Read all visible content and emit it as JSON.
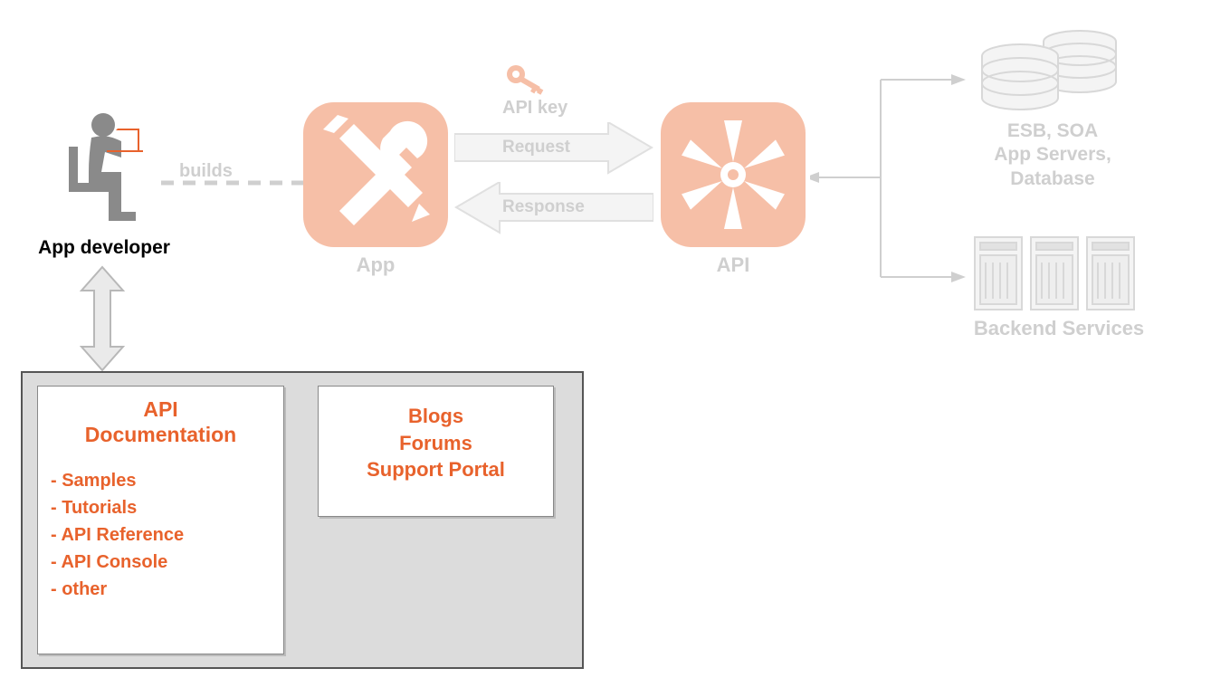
{
  "diagram": {
    "developer_label": "App developer",
    "builds_label": "builds",
    "app_label": "App",
    "api_key_label": "API key",
    "request_label": "Request",
    "response_label": "Response",
    "api_label": "API",
    "backend_top_line1": "ESB, SOA",
    "backend_top_line2": "App Servers,",
    "backend_top_line3": "Database",
    "backend_bottom_label": "Backend Services",
    "docs_box_title_line1": "API",
    "docs_box_title_line2": "Documentation",
    "docs_items": [
      "- Samples",
      "- Tutorials",
      "- API Reference",
      "- API Console",
      "- other"
    ],
    "support_box_line1": "Blogs",
    "support_box_line2": "Forums",
    "support_box_line3": "Support Portal"
  }
}
